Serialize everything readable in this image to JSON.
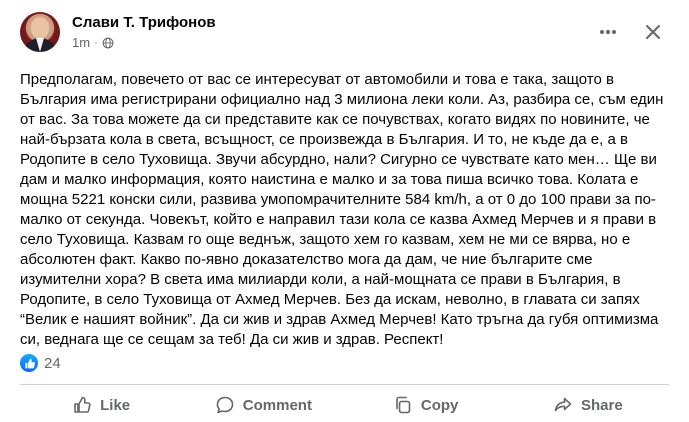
{
  "post": {
    "author": "Слави Т. Трифонов",
    "time": "1m",
    "separator": "·",
    "body": "Предполагам, повечето от вас се интересуват от автомобили и това е така, защото в България има регистрирани официално над 3 милиона леки коли. Аз, разбира се, съм един от вас. За това можете да си представите как се почувствах, когато видях по новините, че най-бързата кола в света, всъщност, се произвежда в България. И то, не къде да е, а в Родопите в село Туховища. Звучи абсурдно, нали? Сигурно се чувствате като мен… Ще ви дам и малко информация, която наистина е малко и за това пиша всичко това. Колата е мощна 5221 конски сили, развива умопомрачителните 584 km/h, а от 0 до 100 прави за по-малко от секунда. Човекът, който е направил тази кола се казва Ахмед Мерчев и я прави в село Туховища. Казвам го още веднъж, защото хем го казвам, хем не ми се вярва, но е абсолютен факт. Какво по-явно доказателство мога да дам, че ние българите сме изумителни хора? В света има милиарди коли, а най-мощната се прави в България, в Родопите, в село Туховища от Ахмед Мерчев. Без да искам, неволно, в главата си запях “Велик е нашият войник”. Да си жив и здрав Ахмед Мерчев! Като тръгна да губя оптимизма си, веднага ще се сещам за теб! Да си жив и здрав. Респект!"
  },
  "reactions": {
    "count": "24",
    "icon": "like-reaction-icon",
    "color": "#0866ff"
  },
  "actions": {
    "like": "Like",
    "comment": "Comment",
    "copy": "Copy",
    "share": "Share"
  },
  "colors": {
    "text": "#050505",
    "secondary": "#65676b",
    "divider": "#ced0d4"
  }
}
